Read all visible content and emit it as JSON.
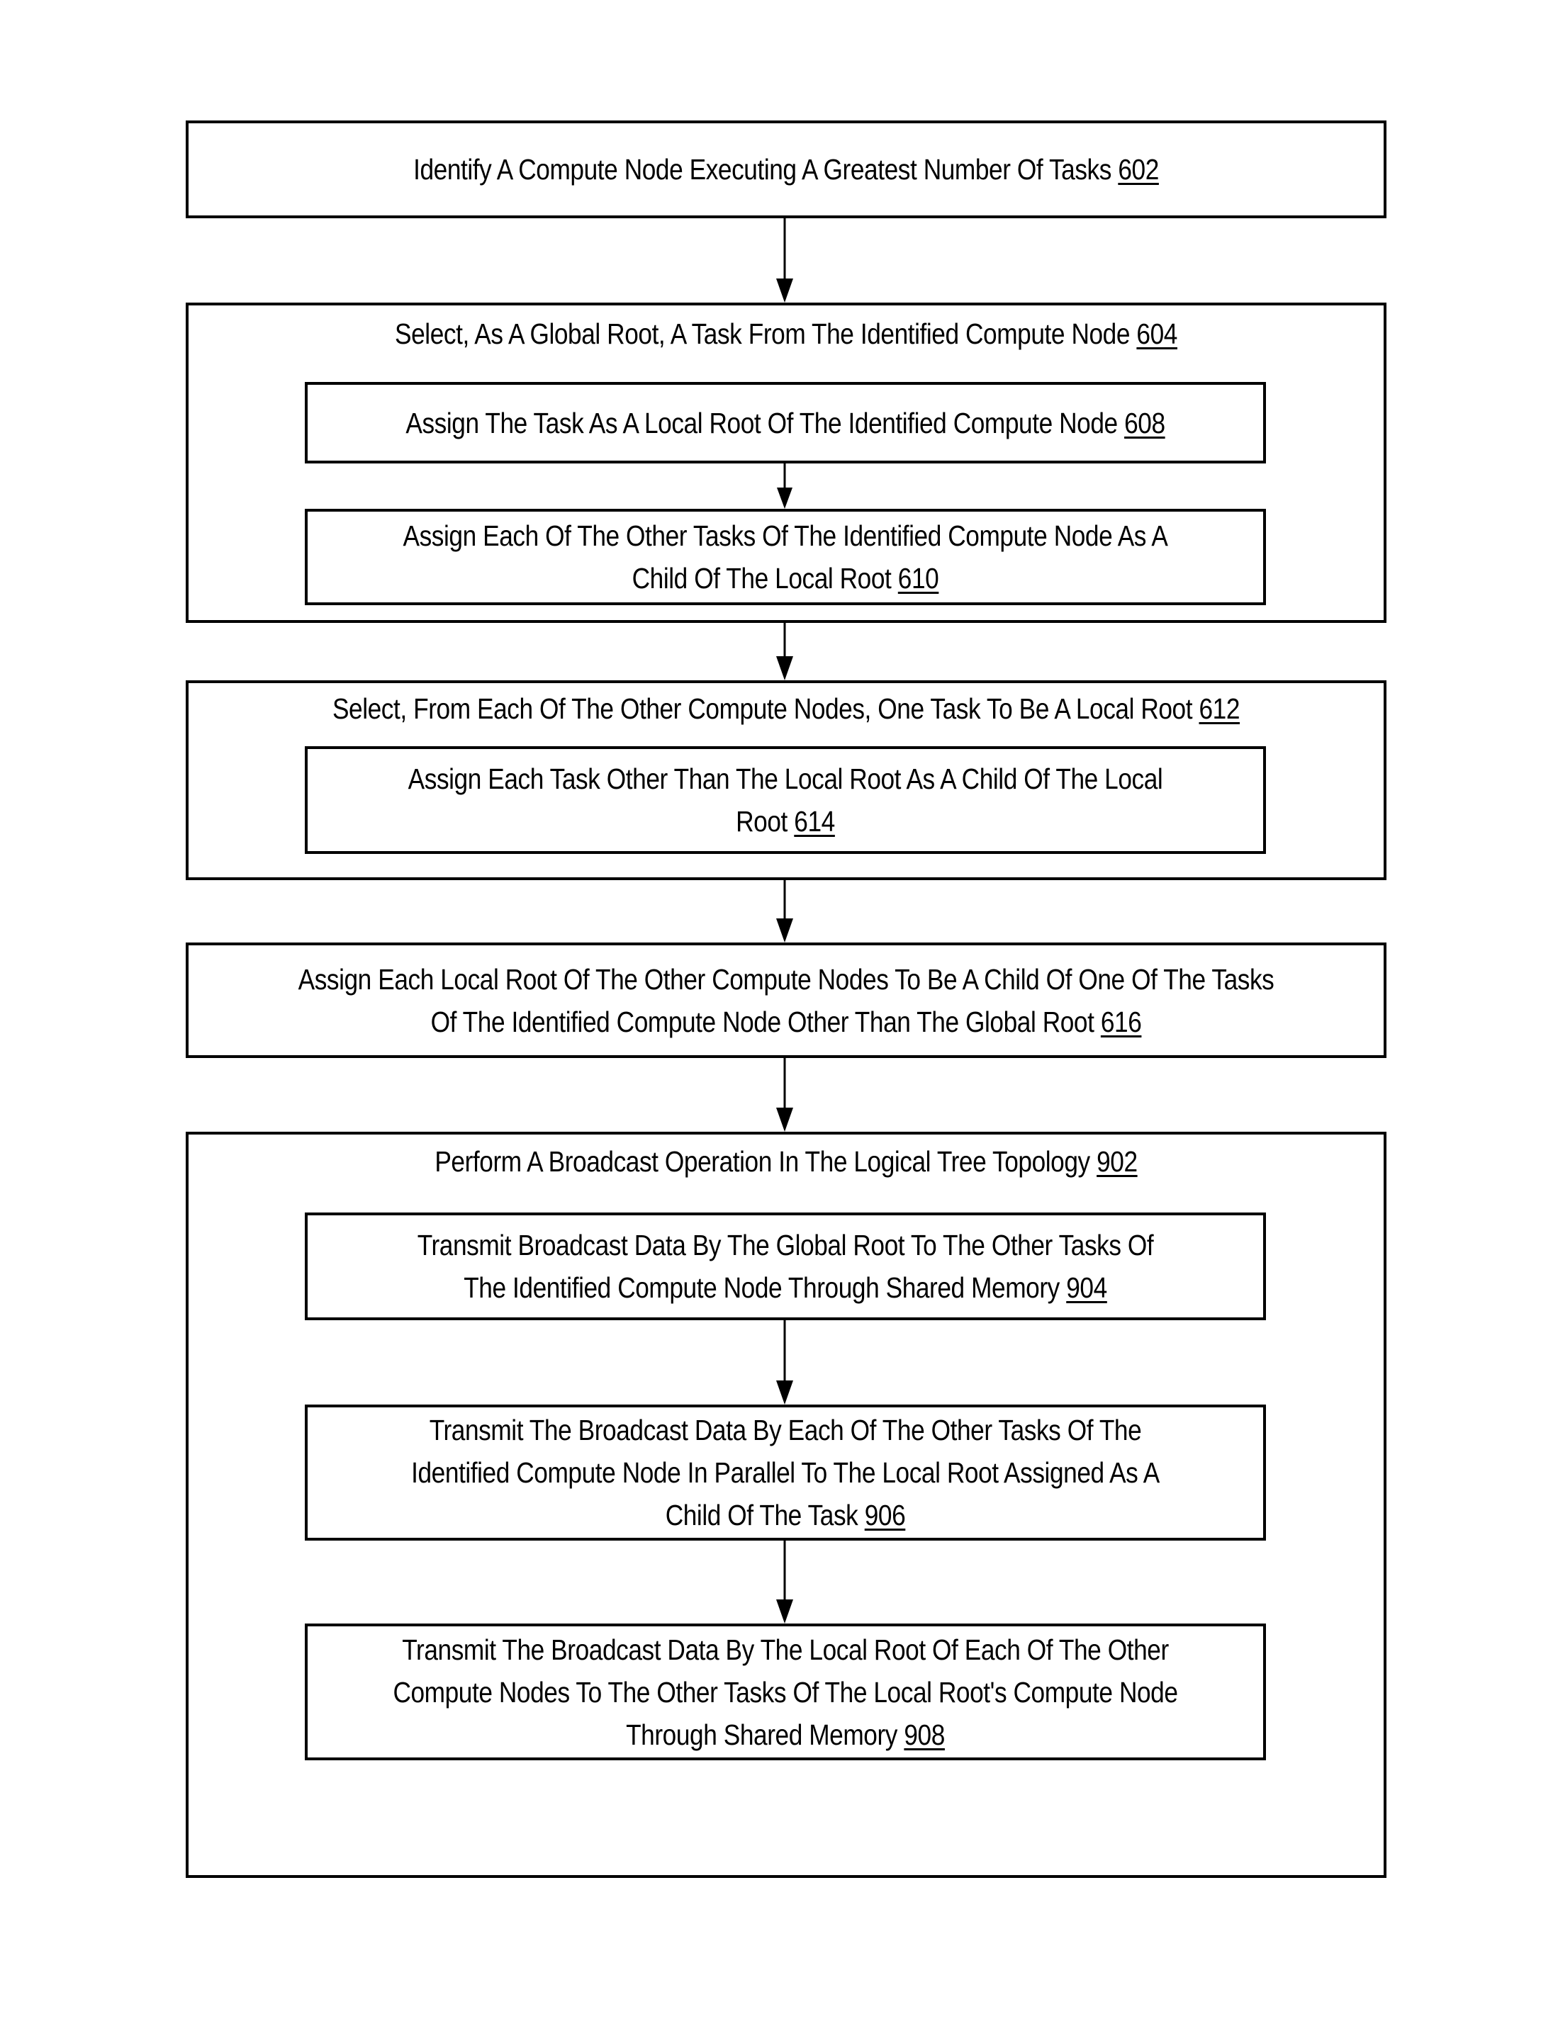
{
  "figure": {
    "steps": {
      "s602": {
        "text": "Identify A Compute Node Executing A Greatest Number Of Tasks",
        "ref": "602"
      },
      "s604": {
        "text": "Select, As A Global Root, A Task From The Identified Compute Node",
        "ref": "604"
      },
      "s608": {
        "text": "Assign The Task As A Local Root Of The Identified Compute Node ",
        "ref": "608"
      },
      "s610": {
        "line1": "Assign Each Of The Other Tasks Of The Identified Compute Node As A",
        "line2": "Child Of The Local Root",
        "ref": "610"
      },
      "s612": {
        "text": "Select, From Each Of The Other Compute Nodes, One Task To Be A Local Root",
        "ref": "612"
      },
      "s614": {
        "line1": "Assign Each Task Other Than The Local Root As A Child Of The Local",
        "line2": "Root",
        "ref": "614"
      },
      "s616": {
        "line1": "Assign Each Local Root Of The Other Compute Nodes To Be A Child Of One Of The Tasks",
        "line2": "Of The Identified Compute Node Other Than The Global Root",
        "ref": "616"
      },
      "s902": {
        "text": "Perform A Broadcast Operation In The Logical Tree Topology",
        "ref": "902"
      },
      "s904": {
        "line1": "Transmit Broadcast Data By The Global Root To The Other Tasks Of",
        "line2": "The Identified Compute Node Through Shared Memory",
        "ref": "904"
      },
      "s906": {
        "line1": "Transmit The Broadcast Data By Each Of The Other Tasks Of The",
        "line2": "Identified Compute Node In Parallel To The Local Root Assigned As A",
        "line3": "Child Of The Task",
        "ref": "906"
      },
      "s908": {
        "line1": "Transmit The Broadcast Data By The Local Root Of Each Of The Other",
        "line2": "Compute Nodes To The Other Tasks Of The Local Root's Compute Node",
        "line3": "Through Shared Memory",
        "ref": "908"
      }
    }
  }
}
